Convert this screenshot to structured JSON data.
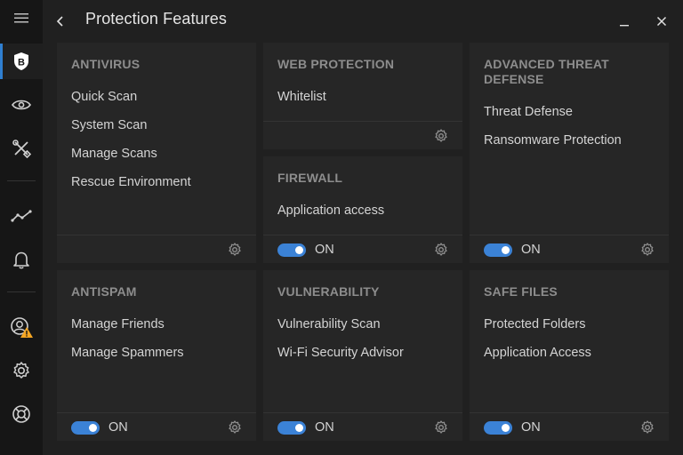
{
  "window": {
    "title": "Protection Features",
    "back_icon": "chevron-left-icon",
    "minimize_icon": "minimize-icon",
    "close_icon": "close-icon"
  },
  "sidebar": {
    "items": [
      {
        "name": "menu-icon"
      },
      {
        "name": "shield-b-icon",
        "active": true
      },
      {
        "name": "eye-icon"
      },
      {
        "name": "tools-icon"
      },
      {
        "name": "activity-icon"
      },
      {
        "name": "bell-icon"
      },
      {
        "name": "account-warning-icon"
      },
      {
        "name": "gear-icon"
      },
      {
        "name": "lifebuoy-icon"
      }
    ]
  },
  "cards": {
    "antivirus": {
      "title": "ANTIVIRUS",
      "links": [
        "Quick Scan",
        "System Scan",
        "Manage Scans",
        "Rescue Environment"
      ]
    },
    "web_protection": {
      "title": "WEB PROTECTION",
      "links": [
        "Whitelist"
      ]
    },
    "atd": {
      "title": "ADVANCED THREAT DEFENSE",
      "links": [
        "Threat Defense",
        "Ransomware Protection"
      ],
      "toggle": "ON"
    },
    "firewall": {
      "title": "FIREWALL",
      "links": [
        "Application access"
      ],
      "toggle": "ON"
    },
    "antispam": {
      "title": "ANTISPAM",
      "links": [
        "Manage Friends",
        "Manage Spammers"
      ],
      "toggle": "ON"
    },
    "vulnerability": {
      "title": "VULNERABILITY",
      "links": [
        "Vulnerability Scan",
        "Wi-Fi Security Advisor"
      ],
      "toggle": "ON"
    },
    "safe_files": {
      "title": "SAFE FILES",
      "links": [
        "Protected Folders",
        "Application Access"
      ],
      "toggle": "ON"
    }
  },
  "colors": {
    "accent": "#3b82d6",
    "warning": "#f5a623",
    "background": "#202020",
    "card": "#262626",
    "sidebar": "#161616"
  }
}
